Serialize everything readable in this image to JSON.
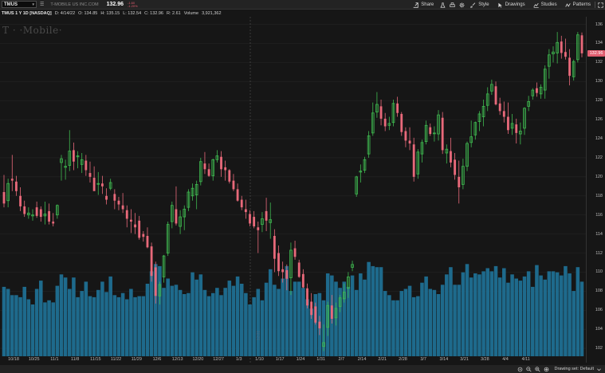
{
  "toolbar": {
    "symbol": "TMUS",
    "company": "T-MOBILE US INC.COM",
    "last": "132.96",
    "change": "-1.60",
    "change_pct": "-1.20%",
    "buttons": {
      "share": "Share",
      "style": "Style",
      "drawings": "Drawings",
      "studies": "Studies",
      "patterns": "Patterns"
    }
  },
  "info": {
    "title": "TMUS 1 Y 1D [NASDAQ]",
    "date": "D: 4/14/22",
    "open": "O: 134.85",
    "high": "H: 135.15",
    "low": "L: 132.54",
    "close": "C: 132.96",
    "range": "R: 2.61",
    "volume_label": "Volume",
    "volume": "3,921,362"
  },
  "watermark": "T · ·Mobile·",
  "price_tag": "132.96",
  "y_ticks": [
    "102",
    "104",
    "106",
    "108",
    "110",
    "112",
    "114",
    "116",
    "118",
    "120",
    "122",
    "124",
    "126",
    "128",
    "130",
    "132",
    "134",
    "136"
  ],
  "x_ticks": [
    "10/18",
    "10/25",
    "11/1",
    "11/8",
    "11/15",
    "11/22",
    "11/29",
    "12/6",
    "12/13",
    "12/20",
    "12/27",
    "1/3",
    "1/10",
    "1/17",
    "1/24",
    "1/31",
    "2/7",
    "2/14",
    "2/21",
    "2/28",
    "3/7",
    "3/14",
    "3/21",
    "3/28",
    "4/4",
    "4/11"
  ],
  "timeline_marker": "12/31",
  "bottombar": {
    "status": "Drawing set: Default"
  },
  "colors": {
    "up": "#3fb950",
    "down": "#e8697a",
    "volume": "#1e6a8c",
    "bg": "#161616",
    "grid": "#242424"
  },
  "chart_data": {
    "type": "candlestick",
    "ylim": [
      100.5,
      136.8
    ],
    "candles": [
      [
        118.4,
        120.2,
        116.8,
        117.2,
        67
      ],
      [
        117.5,
        119.8,
        116.8,
        119.3,
        65
      ],
      [
        119.8,
        122.3,
        118.5,
        119.6,
        59
      ],
      [
        119.5,
        120.1,
        118.0,
        118.5,
        59
      ],
      [
        118.0,
        118.9,
        116.4,
        116.9,
        57
      ],
      [
        116.9,
        117.5,
        115.8,
        116.1,
        67
      ],
      [
        116.0,
        116.8,
        115.6,
        116.2,
        55
      ],
      [
        115.9,
        116.6,
        115.4,
        116.0,
        50
      ],
      [
        116.8,
        117.4,
        115.7,
        115.9,
        65
      ],
      [
        116.6,
        116.9,
        115.3,
        115.8,
        73
      ],
      [
        115.9,
        117.4,
        115.0,
        116.1,
        52
      ],
      [
        116.4,
        117.2,
        115.0,
        115.3,
        54
      ],
      [
        115.3,
        116.2,
        114.8,
        115.1,
        52
      ],
      [
        116.0,
        117.1,
        115.6,
        117.0,
        68
      ],
      [
        121.5,
        122.3,
        119.6,
        121.9,
        79
      ],
      [
        121.0,
        121.8,
        119.7,
        121.1,
        76
      ],
      [
        121.2,
        124.9,
        120.6,
        122.7,
        65
      ],
      [
        122.8,
        123.6,
        120.7,
        121.6,
        76
      ],
      [
        122.1,
        122.7,
        120.9,
        122.2,
        57
      ],
      [
        121.3,
        122.5,
        120.4,
        121.8,
        63
      ],
      [
        121.7,
        122.3,
        120.1,
        120.7,
        72
      ],
      [
        120.4,
        121.6,
        119.4,
        120.0,
        58
      ],
      [
        119.9,
        121.1,
        118.8,
        118.5,
        57
      ],
      [
        119.3,
        120.5,
        118.1,
        119.3,
        64
      ],
      [
        119.3,
        120.1,
        118.2,
        119.0,
        72
      ],
      [
        118.0,
        118.8,
        117.1,
        117.6,
        62
      ],
      [
        118.8,
        119.8,
        118.6,
        119.4,
        77
      ],
      [
        118.2,
        118.7,
        116.6,
        117.5,
        59
      ],
      [
        117.5,
        117.9,
        116.5,
        117.1,
        57
      ],
      [
        117.0,
        118.3,
        116.2,
        116.6,
        61
      ],
      [
        116.5,
        117.0,
        114.7,
        115.6,
        55
      ],
      [
        115.5,
        116.6,
        114.1,
        115.3,
        65
      ],
      [
        115.0,
        116.2,
        114.0,
        114.7,
        57
      ],
      [
        115.4,
        115.9,
        113.4,
        113.6,
        58
      ],
      [
        114.0,
        114.3,
        113.2,
        113.7,
        58
      ],
      [
        113.8,
        114.7,
        112.5,
        112.6,
        70
      ],
      [
        112.7,
        113.1,
        109.0,
        109.6,
        82
      ],
      [
        110.5,
        111.1,
        106.7,
        107.5,
        89
      ],
      [
        107.5,
        109.0,
        106.6,
        108.7,
        87
      ],
      [
        109.5,
        111.8,
        108.9,
        111.7,
        66
      ],
      [
        112.0,
        115.3,
        111.7,
        115.0,
        75
      ],
      [
        115.3,
        117.4,
        114.6,
        117.0,
        68
      ],
      [
        116.6,
        119.0,
        114.9,
        115.1,
        69
      ],
      [
        114.8,
        116.5,
        114.0,
        115.8,
        64
      ],
      [
        115.8,
        117.0,
        114.4,
        116.6,
        60
      ],
      [
        116.8,
        118.7,
        116.4,
        118.4,
        61
      ],
      [
        118.0,
        119.3,
        117.5,
        118.8,
        81
      ],
      [
        118.1,
        119.6,
        116.6,
        119.2,
        74
      ],
      [
        119.5,
        122.0,
        119.1,
        121.6,
        79
      ],
      [
        121.4,
        122.6,
        120.3,
        120.8,
        64
      ],
      [
        120.8,
        121.4,
        120.0,
        120.1,
        58
      ],
      [
        120.1,
        121.9,
        119.6,
        121.8,
        61
      ],
      [
        121.8,
        122.8,
        121.5,
        122.2,
        66
      ],
      [
        122.1,
        122.7,
        120.0,
        120.8,
        59
      ],
      [
        121.0,
        121.7,
        119.6,
        120.7,
        66
      ],
      [
        120.7,
        120.8,
        119.3,
        119.5,
        73
      ],
      [
        119.6,
        120.3,
        118.5,
        118.7,
        68
      ],
      [
        118.7,
        119.3,
        117.4,
        117.5,
        77
      ],
      [
        117.6,
        118.0,
        116.5,
        116.8,
        70
      ],
      [
        116.6,
        117.6,
        115.6,
        116.3,
        61
      ],
      [
        116.1,
        116.5,
        114.8,
        115.1,
        50
      ],
      [
        115.8,
        116.4,
        114.6,
        114.8,
        57
      ],
      [
        114.7,
        115.3,
        112.0,
        114.4,
        65
      ],
      [
        115.0,
        116.3,
        114.2,
        115.6,
        54
      ],
      [
        116.4,
        117.8,
        114.3,
        115.4,
        71
      ],
      [
        115.2,
        117.3,
        113.5,
        115.5,
        84
      ],
      [
        113.8,
        114.5,
        110.0,
        111.4,
        69
      ],
      [
        112.0,
        112.8,
        109.6,
        110.1,
        65
      ],
      [
        110.3,
        111.1,
        108.9,
        110.0,
        75
      ],
      [
        110.2,
        110.8,
        108.1,
        109.3,
        87
      ],
      [
        109.4,
        113.1,
        107.6,
        112.3,
        63
      ],
      [
        112.5,
        113.3,
        111.3,
        111.6,
        72
      ],
      [
        111.0,
        111.3,
        109.4,
        109.5,
        72
      ],
      [
        109.8,
        110.3,
        108.3,
        108.4,
        66
      ],
      [
        108.3,
        108.8,
        106.2,
        106.5,
        55
      ],
      [
        106.9,
        107.8,
        105.1,
        105.5,
        46
      ],
      [
        106.4,
        106.8,
        104.5,
        104.7,
        60
      ],
      [
        104.8,
        105.4,
        103.4,
        104.1,
        61
      ],
      [
        102.2,
        104.5,
        101.7,
        102.6,
        54
      ],
      [
        104.2,
        106.9,
        103.3,
        106.5,
        80
      ],
      [
        106.5,
        107.6,
        104.6,
        105.1,
        78
      ],
      [
        105.2,
        106.8,
        104.4,
        106.2,
        72
      ],
      [
        106.4,
        107.6,
        105.8,
        107.3,
        66
      ],
      [
        107.2,
        108.8,
        106.8,
        107.9,
        72
      ],
      [
        108.3,
        110.0,
        107.3,
        109.5,
        67
      ],
      [
        110.5,
        111.2,
        110.1,
        110.8,
        78
      ],
      [
        118.2,
        120.1,
        117.9,
        120.0,
        64
      ],
      [
        120.5,
        121.3,
        119.4,
        120.6,
        80
      ],
      [
        120.7,
        122.1,
        120.4,
        121.8,
        74
      ],
      [
        122.4,
        124.8,
        122.0,
        124.3,
        91
      ],
      [
        124.6,
        127.8,
        124.3,
        126.7,
        87
      ],
      [
        126.8,
        128.9,
        126.2,
        127.6,
        86
      ],
      [
        127.4,
        128.1,
        125.4,
        126.1,
        86
      ],
      [
        126.1,
        126.7,
        124.8,
        125.3,
        63
      ],
      [
        125.4,
        126.3,
        124.9,
        125.6,
        59
      ],
      [
        125.7,
        128.1,
        125.3,
        127.7,
        54
      ],
      [
        127.7,
        128.4,
        126.3,
        126.7,
        54
      ],
      [
        126.6,
        126.8,
        124.3,
        124.7,
        63
      ],
      [
        124.8,
        125.2,
        123.1,
        123.8,
        65
      ],
      [
        123.8,
        125.2,
        122.8,
        123.5,
        68
      ],
      [
        123.4,
        124.1,
        119.5,
        120.0,
        57
      ],
      [
        120.3,
        122.9,
        119.8,
        122.6,
        58
      ],
      [
        122.4,
        123.9,
        121.5,
        123.6,
        71
      ],
      [
        123.7,
        125.9,
        123.4,
        125.4,
        77
      ],
      [
        125.2,
        125.6,
        124.3,
        124.5,
        65
      ],
      [
        124.6,
        125.3,
        123.7,
        124.6,
        64
      ],
      [
        124.5,
        127.0,
        123.8,
        126.5,
        60
      ],
      [
        126.2,
        126.8,
        122.4,
        122.8,
        69
      ],
      [
        122.5,
        123.4,
        121.4,
        122.9,
        79
      ],
      [
        122.7,
        124.1,
        121.0,
        121.5,
        86
      ],
      [
        121.8,
        122.5,
        119.7,
        120.2,
        69
      ],
      [
        120.0,
        121.7,
        117.2,
        118.9,
        69
      ],
      [
        119.2,
        121.9,
        118.7,
        121.1,
        81
      ],
      [
        121.1,
        123.7,
        120.6,
        123.5,
        89
      ],
      [
        123.6,
        125.9,
        123.1,
        124.2,
        76
      ],
      [
        124.4,
        125.8,
        123.9,
        125.7,
        80
      ],
      [
        125.8,
        126.9,
        124.8,
        126.6,
        79
      ],
      [
        126.3,
        128.1,
        125.3,
        127.4,
        82
      ],
      [
        127.5,
        129.4,
        126.9,
        128.7,
        85
      ],
      [
        129.0,
        130.2,
        128.6,
        129.7,
        82
      ],
      [
        129.5,
        130.0,
        127.5,
        127.6,
        87
      ],
      [
        127.7,
        128.3,
        126.5,
        126.9,
        76
      ],
      [
        126.9,
        127.9,
        125.7,
        126.3,
        85
      ],
      [
        126.3,
        127.8,
        124.5,
        124.9,
        71
      ],
      [
        125.1,
        126.6,
        124.4,
        125.6,
        79
      ],
      [
        125.5,
        126.1,
        123.5,
        124.6,
        75
      ],
      [
        124.5,
        125.7,
        123.4,
        124.8,
        73
      ],
      [
        125.1,
        127.3,
        124.4,
        127.2,
        77
      ],
      [
        127.4,
        128.5,
        126.9,
        127.9,
        82
      ],
      [
        128.5,
        129.3,
        128.1,
        129.1,
        67
      ],
      [
        129.3,
        129.9,
        128.4,
        128.8,
        88
      ],
      [
        128.7,
        129.7,
        128.2,
        129.4,
        78
      ],
      [
        129.1,
        131.7,
        128.2,
        131.3,
        74
      ],
      [
        131.6,
        133.4,
        130.3,
        132.8,
        82
      ],
      [
        132.9,
        133.7,
        132.0,
        133.1,
        82
      ],
      [
        133.0,
        135.2,
        131.9,
        134.1,
        81
      ],
      [
        134.2,
        134.8,
        132.4,
        133.0,
        78
      ],
      [
        133.1,
        134.5,
        132.3,
        132.6,
        87
      ],
      [
        132.5,
        133.4,
        129.6,
        130.6,
        80
      ],
      [
        130.5,
        132.3,
        130.1,
        132.1,
        63
      ],
      [
        132.3,
        135.2,
        132.0,
        134.9,
        86
      ],
      [
        134.85,
        135.15,
        132.54,
        132.96,
        72
      ]
    ]
  }
}
